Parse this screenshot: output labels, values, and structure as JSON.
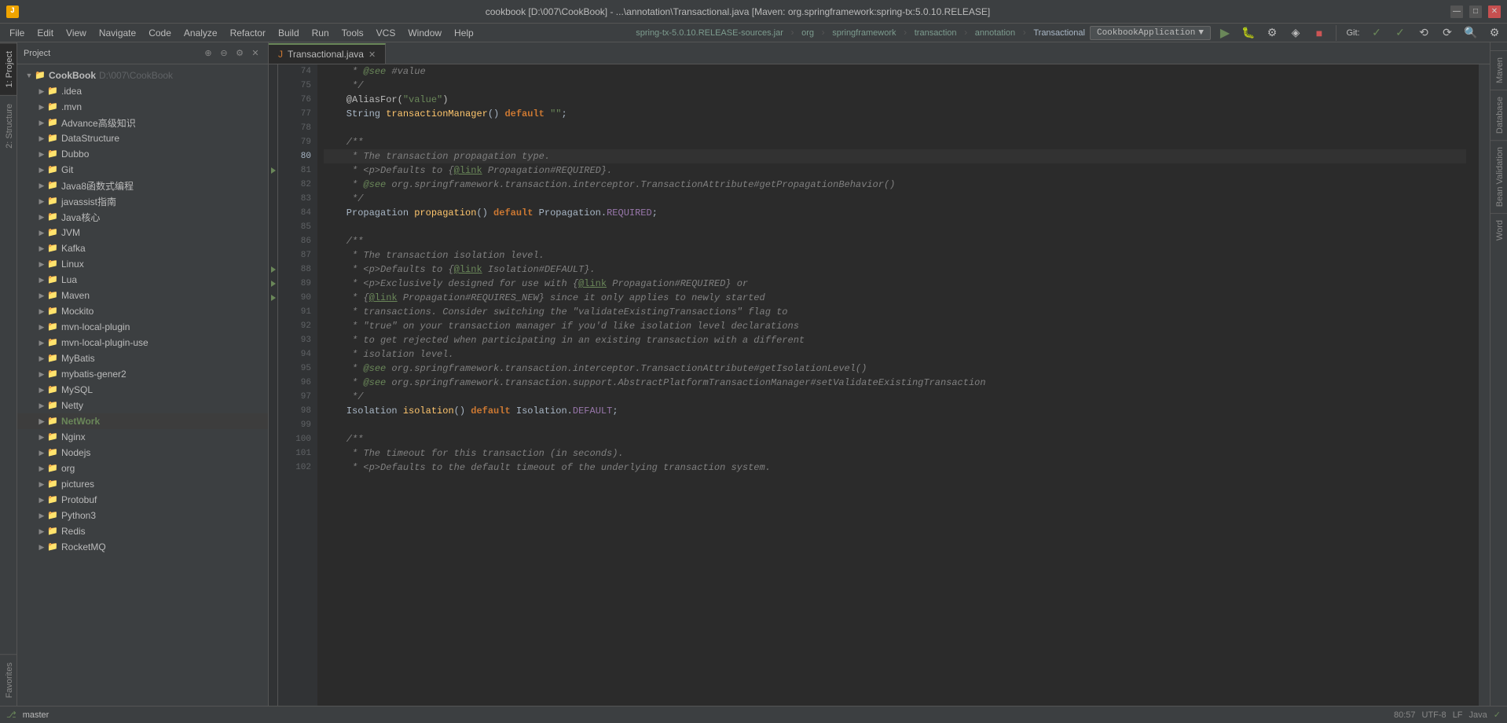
{
  "titleBar": {
    "iconLabel": "J",
    "title": "cookbook [D:\\007\\CookBook] - ...\\annotation\\Transactional.java [Maven: org.springframework:spring-tx:5.0.10.RELEASE]",
    "minBtn": "—",
    "maxBtn": "□",
    "closeBtn": "✕"
  },
  "menuBar": {
    "items": [
      "File",
      "Edit",
      "View",
      "Navigate",
      "Code",
      "Analyze",
      "Refactor",
      "Build",
      "Run",
      "Tools",
      "VCS",
      "Window",
      "Help"
    ]
  },
  "breadcrumb": {
    "items": [
      "spring-tx-5.0.10.RELEASE-sources.jar",
      "org",
      "springframework",
      "transaction",
      "annotation",
      "Transactional"
    ]
  },
  "sidebar": {
    "title": "Project",
    "root": "CookBook",
    "rootPath": "D:\\007\\CookBook",
    "items": [
      {
        "name": ".idea",
        "indent": 1,
        "expanded": false
      },
      {
        "name": ".mvn",
        "indent": 1,
        "expanded": false
      },
      {
        "name": "Advance高级知识",
        "indent": 1,
        "expanded": false
      },
      {
        "name": "DataStructure",
        "indent": 1,
        "expanded": false
      },
      {
        "name": "Dubbo",
        "indent": 1,
        "expanded": false
      },
      {
        "name": "Git",
        "indent": 1,
        "expanded": false
      },
      {
        "name": "Java8函数式编程",
        "indent": 1,
        "expanded": false
      },
      {
        "name": "javassist指南",
        "indent": 1,
        "expanded": false
      },
      {
        "name": "Java核心",
        "indent": 1,
        "expanded": false
      },
      {
        "name": "JVM",
        "indent": 1,
        "expanded": false
      },
      {
        "name": "Kafka",
        "indent": 1,
        "expanded": false
      },
      {
        "name": "Linux",
        "indent": 1,
        "expanded": false
      },
      {
        "name": "Lua",
        "indent": 1,
        "expanded": false
      },
      {
        "name": "Maven",
        "indent": 1,
        "expanded": false
      },
      {
        "name": "Mockito",
        "indent": 1,
        "expanded": false
      },
      {
        "name": "mvn-local-plugin",
        "indent": 1,
        "expanded": false
      },
      {
        "name": "mvn-local-plugin-use",
        "indent": 1,
        "expanded": false
      },
      {
        "name": "MyBatis",
        "indent": 1,
        "expanded": false
      },
      {
        "name": "mybatis-gener2",
        "indent": 1,
        "expanded": false
      },
      {
        "name": "MySQL",
        "indent": 1,
        "expanded": false
      },
      {
        "name": "Netty",
        "indent": 1,
        "expanded": false
      },
      {
        "name": "NetWork",
        "indent": 1,
        "expanded": false,
        "highlighted": true
      },
      {
        "name": "Nginx",
        "indent": 1,
        "expanded": false
      },
      {
        "name": "Nodejs",
        "indent": 1,
        "expanded": false
      },
      {
        "name": "org",
        "indent": 1,
        "expanded": false
      },
      {
        "name": "pictures",
        "indent": 1,
        "expanded": false
      },
      {
        "name": "Protobuf",
        "indent": 1,
        "expanded": false
      },
      {
        "name": "Python3",
        "indent": 1,
        "expanded": false
      },
      {
        "name": "Redis",
        "indent": 1,
        "expanded": false
      },
      {
        "name": "RocketMQ",
        "indent": 1,
        "expanded": false
      }
    ]
  },
  "tabs": {
    "active": "Transactional.java",
    "items": [
      {
        "name": "Transactional.java",
        "active": true
      }
    ]
  },
  "vtabs": {
    "left": [
      "1: Project",
      "2: Structure",
      "Favorites"
    ],
    "right": [
      "Maven",
      "Database",
      "Bean Validation",
      "Word"
    ]
  },
  "editor": {
    "lines": [
      {
        "num": 74,
        "content": [
          {
            "type": "comment",
            "text": "     * @see #value"
          }
        ],
        "gutter": false
      },
      {
        "num": 75,
        "content": [
          {
            "type": "comment",
            "text": "     */"
          }
        ],
        "gutter": false
      },
      {
        "num": 76,
        "content": [
          {
            "type": "annotation",
            "text": "    @AliasFor(\"value\")"
          }
        ],
        "gutter": false
      },
      {
        "num": 77,
        "content": [
          {
            "type": "mixed",
            "parts": [
              {
                "t": "type",
                "v": "    String "
              },
              {
                "t": "method",
                "v": "transactionManager"
              },
              {
                "t": "plain",
                "v": "() "
              },
              {
                "t": "kw",
                "v": "default"
              },
              {
                "t": "str",
                "v": " \"\""
              },
              {
                "t": "plain",
                "v": ";"
              }
            ]
          }
        ],
        "gutter": false
      },
      {
        "num": 78,
        "content": [],
        "gutter": false
      },
      {
        "num": 79,
        "content": [
          {
            "type": "comment",
            "text": "    /**"
          }
        ],
        "gutter": false
      },
      {
        "num": 80,
        "content": [
          {
            "type": "comment_italic",
            "text": "     * The transaction propagation type.",
            "cursor": true
          }
        ],
        "gutter": false,
        "active": true
      },
      {
        "num": 81,
        "content": [
          {
            "type": "comment_link",
            "before": "     * <p>Defaults to {",
            "link": "@link",
            "after": " Propagation#REQUIRED}."
          }
        ],
        "gutter": true
      },
      {
        "num": 82,
        "content": [
          {
            "type": "comment_see",
            "text": "     * @see org.springframework.transaction.interceptor.TransactionAttribute#getPropagationBehavior()"
          }
        ],
        "gutter": false
      },
      {
        "num": 83,
        "content": [
          {
            "type": "comment",
            "text": "     */"
          }
        ],
        "gutter": false
      },
      {
        "num": 84,
        "content": [
          {
            "type": "mixed",
            "parts": [
              {
                "t": "type",
                "v": "    Propagation "
              },
              {
                "t": "method",
                "v": "propagation"
              },
              {
                "t": "plain",
                "v": "() "
              },
              {
                "t": "kw",
                "v": "default"
              },
              {
                "t": "plain",
                "v": " Propagation."
              },
              {
                "t": "required",
                "v": "REQUIRED"
              },
              {
                "t": "plain",
                "v": ";"
              }
            ]
          }
        ],
        "gutter": false
      },
      {
        "num": 85,
        "content": [],
        "gutter": false
      },
      {
        "num": 86,
        "content": [
          {
            "type": "comment",
            "text": "    /**"
          }
        ],
        "gutter": false
      },
      {
        "num": 87,
        "content": [
          {
            "type": "comment_italic",
            "text": "     * The transaction isolation level."
          }
        ],
        "gutter": false
      },
      {
        "num": 88,
        "content": [
          {
            "type": "comment_link",
            "before": "     * <p>Defaults to {",
            "link": "@link",
            "after": " Isolation#DEFAULT}."
          }
        ],
        "gutter": true
      },
      {
        "num": 89,
        "content": [
          {
            "type": "comment_link2",
            "before": "     * <p>Exclusively designed for use with {",
            "link": "@link",
            "after": " Propagation#REQUIRED} or"
          }
        ],
        "gutter": true
      },
      {
        "num": 90,
        "content": [
          {
            "type": "comment_link2",
            "before": "     * {",
            "link": "@link",
            "after": " Propagation#REQUIRES_NEW} since it only applies to newly started"
          }
        ],
        "gutter": true
      },
      {
        "num": 91,
        "content": [
          {
            "type": "comment_italic",
            "text": "     * transactions. Consider switching the \"validateExistingTransactions\" flag to"
          }
        ],
        "gutter": false
      },
      {
        "num": 92,
        "content": [
          {
            "type": "comment_italic",
            "text": "     * \"true\" on your transaction manager if you'd like isolation level declarations"
          }
        ],
        "gutter": false
      },
      {
        "num": 93,
        "content": [
          {
            "type": "comment_italic",
            "text": "     * to get rejected when participating in an existing transaction with a different"
          }
        ],
        "gutter": false
      },
      {
        "num": 94,
        "content": [
          {
            "type": "comment_italic",
            "text": "     * isolation level."
          }
        ],
        "gutter": false
      },
      {
        "num": 95,
        "content": [
          {
            "type": "comment_see",
            "text": "     * @see org.springframework.transaction.interceptor.TransactionAttribute#getIsolationLevel()"
          }
        ],
        "gutter": false
      },
      {
        "num": 96,
        "content": [
          {
            "type": "comment_see",
            "text": "     * @see org.springframework.transaction.support.AbstractPlatformTransactionManager#setValidateExistingTransaction"
          }
        ],
        "gutter": false
      },
      {
        "num": 97,
        "content": [
          {
            "type": "comment",
            "text": "     */"
          }
        ],
        "gutter": false
      },
      {
        "num": 98,
        "content": [
          {
            "type": "mixed",
            "parts": [
              {
                "t": "type",
                "v": "    Isolation "
              },
              {
                "t": "method",
                "v": "isolation"
              },
              {
                "t": "plain",
                "v": "() "
              },
              {
                "t": "kw",
                "v": "default"
              },
              {
                "t": "plain",
                "v": " Isolation."
              },
              {
                "t": "required",
                "v": "DEFAULT"
              },
              {
                "t": "plain",
                "v": ";"
              }
            ]
          }
        ],
        "gutter": false
      },
      {
        "num": 99,
        "content": [],
        "gutter": false
      },
      {
        "num": 100,
        "content": [
          {
            "type": "comment",
            "text": "    /**"
          }
        ],
        "gutter": false
      },
      {
        "num": 101,
        "content": [
          {
            "type": "comment_italic",
            "text": "     * The timeout for this transaction (in seconds)."
          }
        ],
        "gutter": false
      },
      {
        "num": 102,
        "content": [
          {
            "type": "comment_link",
            "before": "     * <p>Defaults to the default timeout of the underlying transaction system.",
            "link": "",
            "after": ""
          }
        ],
        "gutter": false
      }
    ]
  },
  "bottomBar": {
    "line": "80",
    "col": "57",
    "encoding": "UTF-8",
    "lineSep": "LF",
    "lang": "Java",
    "gitBranch": "master"
  },
  "runConfig": {
    "label": "CookbookApplication",
    "chevron": "▼"
  }
}
